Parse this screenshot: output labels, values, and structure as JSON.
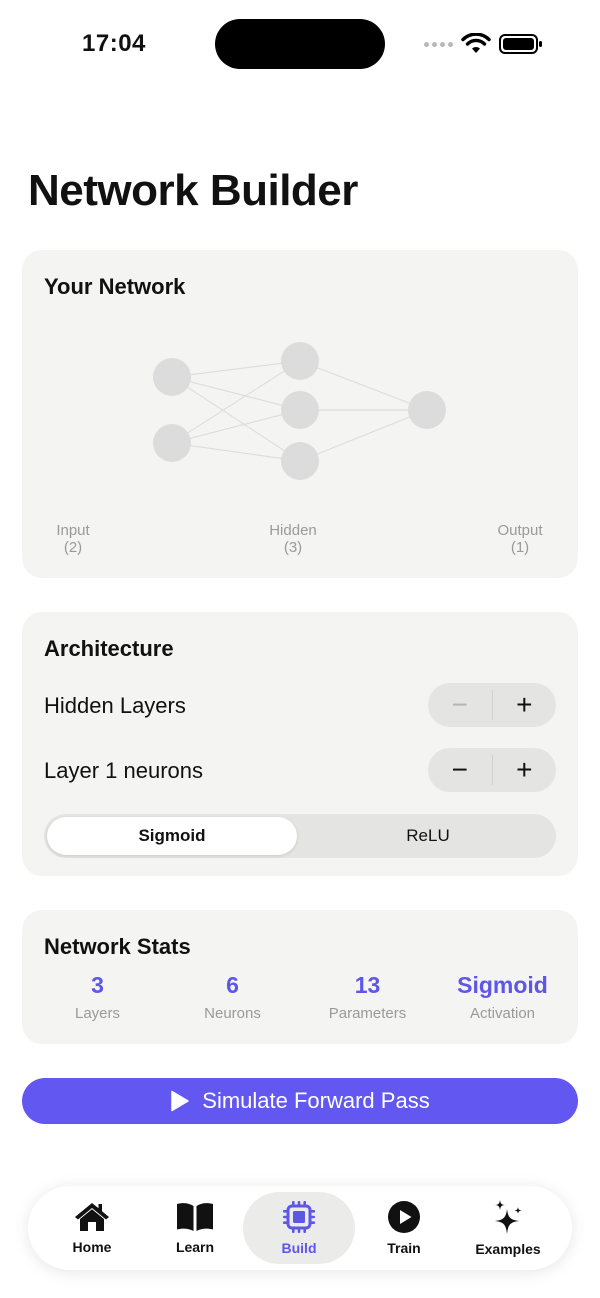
{
  "status_bar": {
    "time": "17:04"
  },
  "page": {
    "title": "Network Builder"
  },
  "network_card": {
    "title": "Your Network",
    "layers": [
      {
        "name": "Input",
        "count": "(2)"
      },
      {
        "name": "Hidden",
        "count": "(3)"
      },
      {
        "name": "Output",
        "count": "(1)"
      }
    ]
  },
  "architecture": {
    "title": "Architecture",
    "hidden_layers_label": "Hidden Layers",
    "layer_neurons_label": "Layer 1 neurons",
    "minus_symbol": "−",
    "plus_symbol": "+",
    "activation_options": [
      "Sigmoid",
      "ReLU"
    ],
    "selected_activation": "Sigmoid"
  },
  "stats": {
    "title": "Network Stats",
    "items": [
      {
        "value": "3",
        "label": "Layers"
      },
      {
        "value": "6",
        "label": "Neurons"
      },
      {
        "value": "13",
        "label": "Parameters"
      },
      {
        "value": "Sigmoid",
        "label": "Activation"
      }
    ]
  },
  "simulate_button": {
    "label": "Simulate Forward Pass"
  },
  "tabs": [
    {
      "label": "Home",
      "icon": "house-icon"
    },
    {
      "label": "Learn",
      "icon": "book-icon"
    },
    {
      "label": "Build",
      "icon": "cpu-icon",
      "active": true
    },
    {
      "label": "Train",
      "icon": "play-circle-icon"
    },
    {
      "label": "Examples",
      "icon": "sparkles-icon"
    }
  ],
  "colors": {
    "accent": "#5e56e7",
    "button": "#6257f0",
    "card_bg": "#f4f4f3",
    "neuron": "#d9d9d9"
  }
}
